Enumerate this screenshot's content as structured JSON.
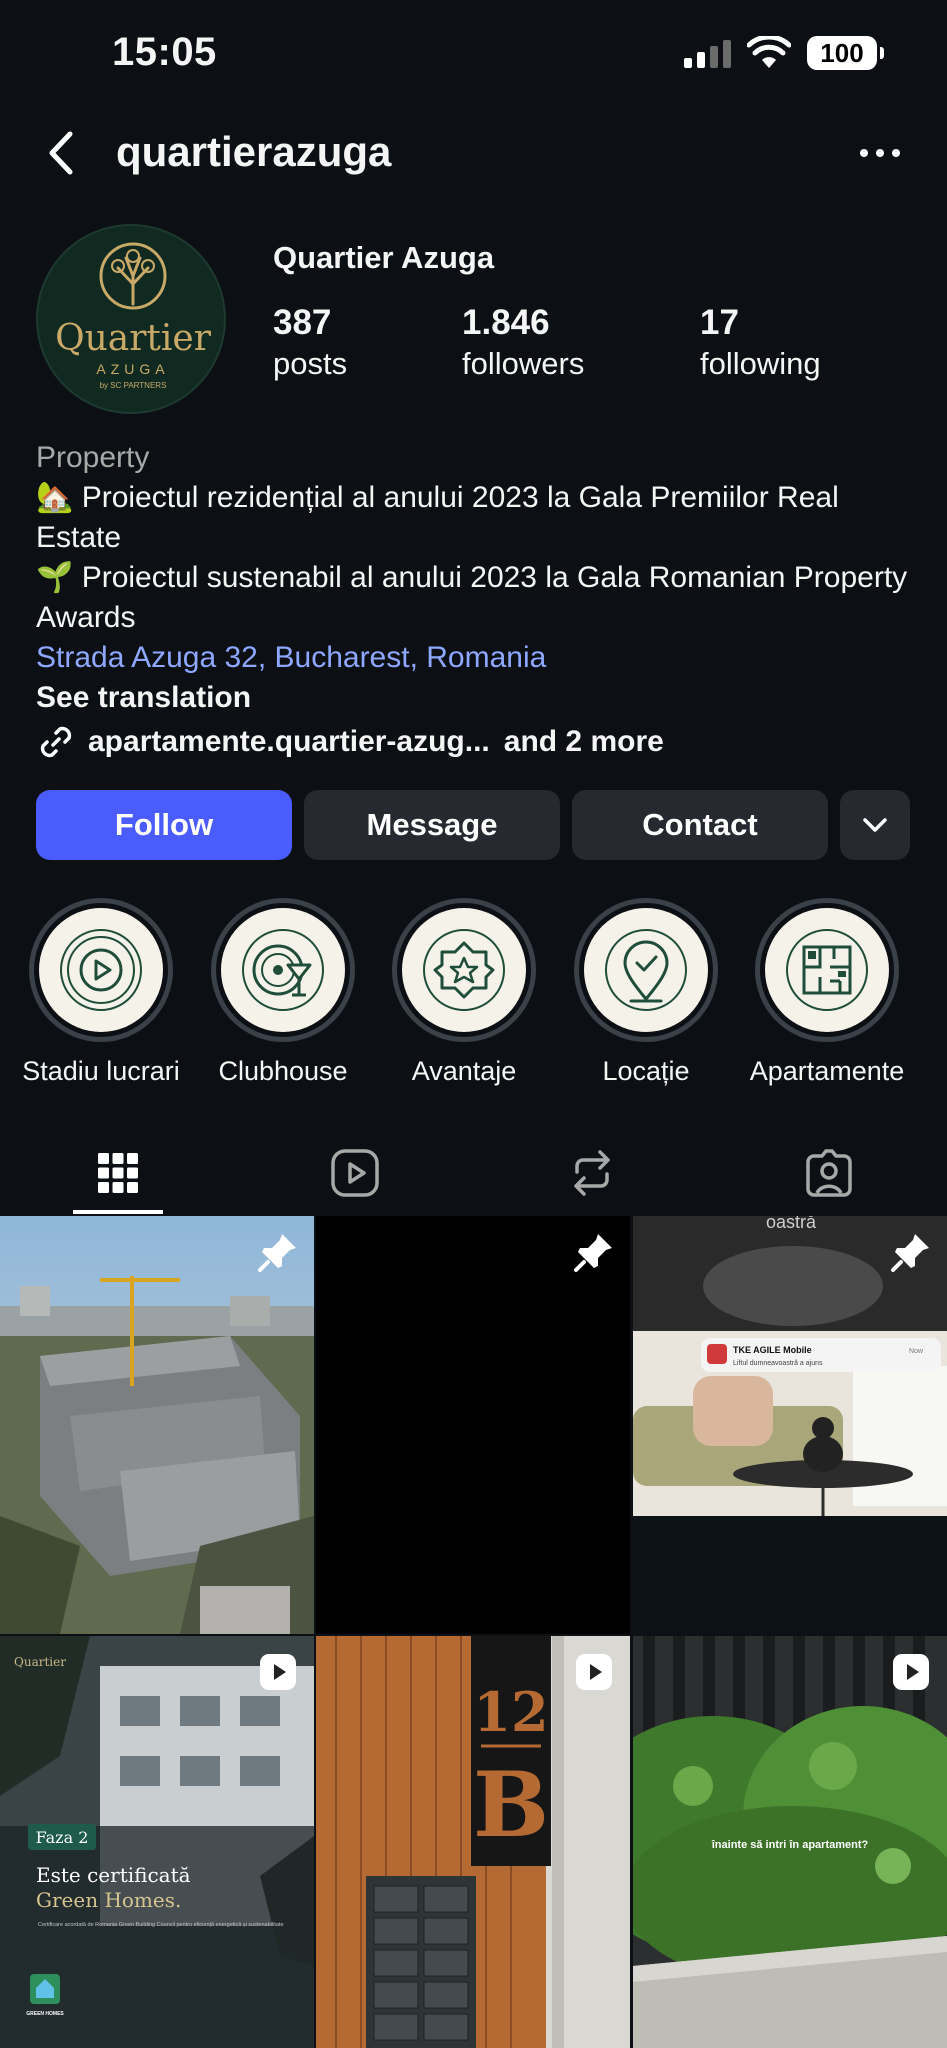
{
  "status": {
    "time": "15:05",
    "battery": "100"
  },
  "header": {
    "username": "quartierazuga"
  },
  "profile": {
    "display_name": "Quartier Azuga",
    "avatar_text": {
      "line1": "Quartier",
      "line2": "AZUGA",
      "line3": "by SC PARTNERS"
    },
    "stats": [
      {
        "value": "387",
        "label": "posts"
      },
      {
        "value": "1.846",
        "label": "followers"
      },
      {
        "value": "17",
        "label": "following"
      }
    ]
  },
  "bio": {
    "category": "Property",
    "line1": "🏡 Proiectul rezidențial al anului 2023 la Gala Premiilor Real Estate",
    "line2": "🌱 Proiectul sustenabil al anului 2023 la Gala Romanian Property Awards",
    "location": "Strada Azuga 32, Bucharest, Romania",
    "see_translation": "See translation",
    "link": "apartamente.quartier-azug...",
    "more_links": "and 2 more"
  },
  "buttons": {
    "follow": "Follow",
    "message": "Message",
    "contact": "Contact"
  },
  "highlights": [
    {
      "label": "Stadiu lucrari",
      "icon": "play-circle-icon"
    },
    {
      "label": "Clubhouse",
      "icon": "vinyl-cocktail-icon"
    },
    {
      "label": "Avantaje",
      "icon": "star-badge-icon"
    },
    {
      "label": "Locație",
      "icon": "location-pin-icon"
    },
    {
      "label": "Apartamente",
      "icon": "floor-plan-icon"
    }
  ],
  "tabs": [
    "grid-icon",
    "reels-icon",
    "reposts-icon",
    "tagged-icon"
  ],
  "posts": [
    {
      "type": "pinned",
      "overlay_text": ""
    },
    {
      "type": "pinned",
      "overlay_text": ""
    },
    {
      "type": "pinned",
      "overlay_text": "oastră",
      "notification_title": "TKE AGILE Mobile",
      "notification_time": "Now",
      "notification_body": "Liftul dumneavoastră a ajuns"
    },
    {
      "type": "reel",
      "logo": "Quartier",
      "tag": "Faza 2",
      "headline": "Este certificată",
      "headline2": "Green Homes.",
      "caption": "Certificare acordată de Romania Green Building Council pentru eficiență energetică și sustenabilitate",
      "brand": "GREEN HOMES"
    },
    {
      "type": "reel",
      "sign_number": "12",
      "sign_letter": "B"
    },
    {
      "type": "reel",
      "subtitle": "înainte să intri în apartament?"
    }
  ],
  "colors": {
    "background": "#0c1014",
    "follow": "#4a5dfc",
    "button": "#262a30",
    "link": "#8ea7ff",
    "muted": "#a8a8a8"
  }
}
